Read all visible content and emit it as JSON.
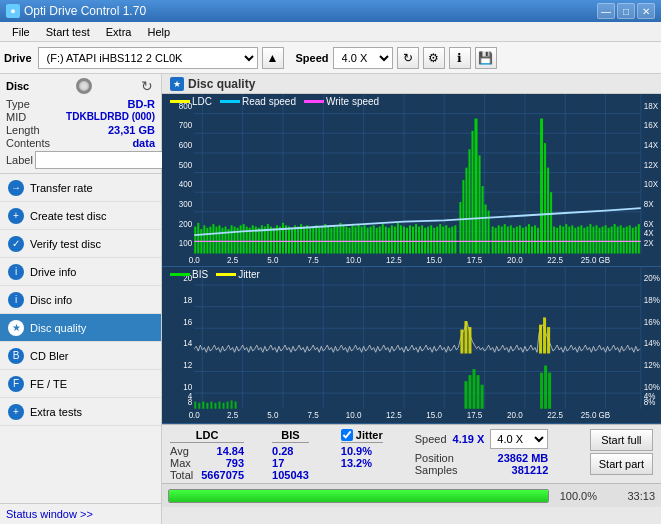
{
  "titlebar": {
    "title": "Opti Drive Control 1.70",
    "min": "—",
    "max": "□",
    "close": "✕"
  },
  "menubar": {
    "items": [
      "File",
      "Start test",
      "Extra",
      "Help"
    ]
  },
  "toolbar": {
    "drive_label": "Drive",
    "drive_value": "(F:)  ATAPI iHBS112  2 CL0K",
    "speed_label": "Speed",
    "speed_value": "4.0 X"
  },
  "disc": {
    "section_label": "Disc",
    "type_label": "Type",
    "type_value": "BD-R",
    "mid_label": "MID",
    "mid_value": "TDKBLDRBD (000)",
    "length_label": "Length",
    "length_value": "23,31 GB",
    "contents_label": "Contents",
    "contents_value": "data",
    "label_label": "Label"
  },
  "nav": {
    "items": [
      "Transfer rate",
      "Create test disc",
      "Verify test disc",
      "Drive info",
      "Disc info",
      "Disc quality",
      "CD Bler",
      "FE / TE",
      "Extra tests"
    ],
    "active": "Disc quality"
  },
  "status": {
    "label": "Status window >>"
  },
  "chart": {
    "title": "Disc quality",
    "top_legend": [
      "LDC",
      "Read speed",
      "Write speed"
    ],
    "bottom_legend": [
      "BIS",
      "Jitter"
    ],
    "top_y_left_max": 800,
    "top_y_right_max": "18X",
    "bottom_y_left_max": 20,
    "bottom_y_right_max": "20%",
    "x_max": "25.0 GB"
  },
  "stats": {
    "ldc_header": "LDC",
    "bis_header": "BIS",
    "jitter_header": "Jitter",
    "speed_header": "Speed",
    "position_header": "Position",
    "samples_header": "Samples",
    "avg_label": "Avg",
    "max_label": "Max",
    "total_label": "Total",
    "ldc_avg": "14.84",
    "ldc_max": "793",
    "ldc_total": "5667075",
    "bis_avg": "0.28",
    "bis_max": "17",
    "bis_total": "105043",
    "jitter_avg": "10.9%",
    "jitter_max": "13.2%",
    "jitter_total": "",
    "speed_value": "4.19 X",
    "speed_select": "4.0 X",
    "position_value": "23862 MB",
    "samples_value": "381212",
    "start_full": "Start full",
    "start_part": "Start part"
  },
  "progress": {
    "percent": "100.0%",
    "time": "33:13",
    "fill_width": "100"
  }
}
